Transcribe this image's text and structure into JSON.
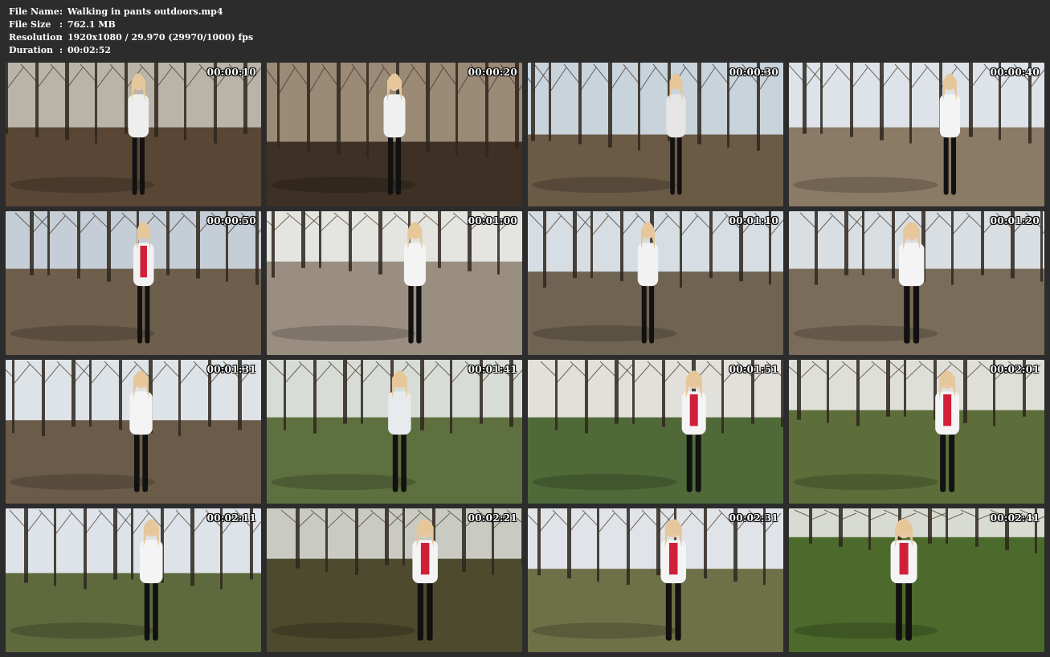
{
  "info": {
    "file_name_label": "File Name",
    "file_name": "Walking in pants outdoors.mp4",
    "file_size_label": "File Size",
    "file_size": "762.1 MB",
    "resolution_label": "Resolution",
    "resolution": "1920x1080 / 29.970 (29970/1000) fps",
    "duration_label": "Duration",
    "duration": "00:02:52",
    "separator": ":"
  },
  "thumbnails": [
    {
      "timestamp": "00:00:10"
    },
    {
      "timestamp": "00:00:20"
    },
    {
      "timestamp": "00:00:30"
    },
    {
      "timestamp": "00:00:40"
    },
    {
      "timestamp": "00:00:50"
    },
    {
      "timestamp": "00:01:00"
    },
    {
      "timestamp": "00:01:10"
    },
    {
      "timestamp": "00:01:20"
    },
    {
      "timestamp": "00:01:31"
    },
    {
      "timestamp": "00:01:41"
    },
    {
      "timestamp": "00:01:51"
    },
    {
      "timestamp": "00:02:01"
    },
    {
      "timestamp": "00:02:11"
    },
    {
      "timestamp": "00:02:21"
    },
    {
      "timestamp": "00:02:31"
    },
    {
      "timestamp": "00:02:41"
    }
  ],
  "colors": {
    "background": "#2c2c2c",
    "text": "#ffffff"
  }
}
